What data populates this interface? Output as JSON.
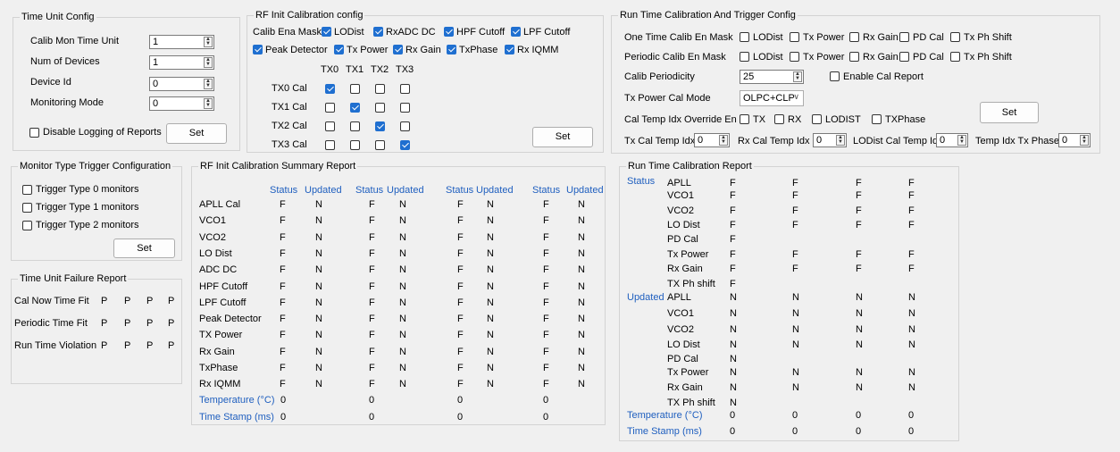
{
  "time_unit_config": {
    "title": "Time Unit Config",
    "fields": [
      {
        "label": "Calib Mon Time Unit",
        "value": "1"
      },
      {
        "label": "Num of  Devices",
        "value": "1"
      },
      {
        "label": "Device Id",
        "value": "0"
      },
      {
        "label": "Monitoring Mode",
        "value": "0"
      }
    ],
    "disable_logging_label": "Disable Logging of Reports",
    "disable_logging_checked": false,
    "set_label": "Set"
  },
  "rf_init_cal_config": {
    "title": "RF Init Calibration config",
    "ena_mask_label": "Calib Ena Mask",
    "mask_items": [
      {
        "label": "LODist",
        "checked": true
      },
      {
        "label": "RxADC DC",
        "checked": true
      },
      {
        "label": "HPF Cutoff",
        "checked": true
      },
      {
        "label": "LPF Cutoff",
        "checked": true
      },
      {
        "label": "Peak Detector",
        "checked": true
      },
      {
        "label": "Tx Power",
        "checked": true
      },
      {
        "label": "Rx Gain",
        "checked": true
      },
      {
        "label": "TxPhase",
        "checked": true
      },
      {
        "label": "Rx IQMM",
        "checked": true
      }
    ],
    "tx_columns": [
      "TX0",
      "TX1",
      "TX2",
      "TX3"
    ],
    "tx_rows": [
      {
        "label": "TX0 Cal",
        "checks": [
          true,
          false,
          false,
          false
        ]
      },
      {
        "label": "TX1 Cal",
        "checks": [
          false,
          true,
          false,
          false
        ]
      },
      {
        "label": "TX2 Cal",
        "checks": [
          false,
          false,
          true,
          false
        ]
      },
      {
        "label": "TX3 Cal",
        "checks": [
          false,
          false,
          false,
          true
        ]
      }
    ],
    "set_label": "Set"
  },
  "run_time_cal_config": {
    "title": "Run Time Calibration And Trigger Config",
    "mask_options": [
      "LODist",
      "Tx Power",
      "Rx Gain",
      "PD Cal",
      "Tx Ph Shift"
    ],
    "one_time_label": "One Time Calib En Mask",
    "periodic_label": "Periodic Calib En Mask",
    "periodicity_label": "Calib Periodicity",
    "periodicity_value": "25",
    "enable_cal_report_label": "Enable Cal Report",
    "tx_power_mode_label": "Tx Power Cal Mode",
    "tx_power_mode_value": "OLPC+CLP",
    "override_label": "Cal Temp Idx Override En",
    "override_options": [
      "TX",
      "RX",
      "LODIST",
      "TXPhase"
    ],
    "tx_temp_label": "Tx Cal Temp Idx",
    "tx_temp_value": "0",
    "rx_temp_label": "Rx Cal Temp Idx",
    "rx_temp_value": "0",
    "lodist_temp_label": "LODist Cal Temp Idx",
    "lodist_temp_value": "0",
    "txphase_temp_label": "Temp Idx Tx Phase",
    "txphase_temp_value": "0",
    "set_label": "Set"
  },
  "monitor_trigger": {
    "title": "Monitor Type Trigger Configuration",
    "options": [
      "Trigger Type 0 monitors",
      "Trigger Type 1 monitors",
      "Trigger Type 2 monitors"
    ],
    "set_label": "Set"
  },
  "time_unit_failure": {
    "title": "Time Unit Failure Report",
    "rows": [
      {
        "label": "Cal Now Time Fit",
        "values": [
          "P",
          "P",
          "P",
          "P"
        ]
      },
      {
        "label": "Periodic Time Fit",
        "values": [
          "P",
          "P",
          "P",
          "P"
        ]
      },
      {
        "label": "Run Time Violation",
        "values": [
          "P",
          "P",
          "P",
          "P"
        ]
      }
    ]
  },
  "rf_init_summary": {
    "title": "RF Init Calibration Summary Report",
    "headers": [
      "Status",
      "Updated"
    ],
    "rows": [
      {
        "label": "APLL Cal",
        "values": [
          "F",
          "N",
          "F",
          "N",
          "F",
          "N",
          "F",
          "N"
        ]
      },
      {
        "label": "VCO1",
        "values": [
          "F",
          "N",
          "F",
          "N",
          "F",
          "N",
          "F",
          "N"
        ]
      },
      {
        "label": "VCO2",
        "values": [
          "F",
          "N",
          "F",
          "N",
          "F",
          "N",
          "F",
          "N"
        ]
      },
      {
        "label": "LO Dist",
        "values": [
          "F",
          "N",
          "F",
          "N",
          "F",
          "N",
          "F",
          "N"
        ]
      },
      {
        "label": "ADC DC",
        "values": [
          "F",
          "N",
          "F",
          "N",
          "F",
          "N",
          "F",
          "N"
        ]
      },
      {
        "label": "HPF Cutoff",
        "values": [
          "F",
          "N",
          "F",
          "N",
          "F",
          "N",
          "F",
          "N"
        ]
      },
      {
        "label": "LPF Cutoff",
        "values": [
          "F",
          "N",
          "F",
          "N",
          "F",
          "N",
          "F",
          "N"
        ]
      },
      {
        "label": "Peak Detector",
        "values": [
          "F",
          "N",
          "F",
          "N",
          "F",
          "N",
          "F",
          "N"
        ]
      },
      {
        "label": "TX Power",
        "values": [
          "F",
          "N",
          "F",
          "N",
          "F",
          "N",
          "F",
          "N"
        ]
      },
      {
        "label": "Rx Gain",
        "values": [
          "F",
          "N",
          "F",
          "N",
          "F",
          "N",
          "F",
          "N"
        ]
      },
      {
        "label": "TxPhase",
        "values": [
          "F",
          "N",
          "F",
          "N",
          "F",
          "N",
          "F",
          "N"
        ]
      },
      {
        "label": "Rx IQMM",
        "values": [
          "F",
          "N",
          "F",
          "N",
          "F",
          "N",
          "F",
          "N"
        ]
      }
    ],
    "temperature_label": "Temperature (°C)",
    "temperature_values": [
      "0",
      "0",
      "0",
      "0"
    ],
    "timestamp_label": "Time Stamp (ms)",
    "timestamp_values": [
      "0",
      "0",
      "0",
      "0"
    ]
  },
  "run_time_report": {
    "title": "Run Time Calibration Report",
    "status_label": "Status",
    "updated_label": "Updated",
    "status_rows": [
      {
        "label": "APLL",
        "values": [
          "F",
          "F",
          "F",
          "F"
        ]
      },
      {
        "label": "VCO1",
        "values": [
          "F",
          "F",
          "F",
          "F"
        ]
      },
      {
        "label": "VCO2",
        "values": [
          "F",
          "F",
          "F",
          "F"
        ]
      },
      {
        "label": "LO Dist",
        "values": [
          "F",
          "F",
          "F",
          "F"
        ]
      },
      {
        "label": "PD Cal",
        "values": [
          "F"
        ]
      },
      {
        "label": "Tx Power",
        "values": [
          "F",
          "F",
          "F",
          "F"
        ]
      },
      {
        "label": "Rx Gain",
        "values": [
          "F",
          "F",
          "F",
          "F"
        ]
      },
      {
        "label": "TX Ph shift",
        "values": [
          "F"
        ]
      }
    ],
    "updated_rows": [
      {
        "label": "APLL",
        "values": [
          "N",
          "N",
          "N",
          "N"
        ]
      },
      {
        "label": "VCO1",
        "values": [
          "N",
          "N",
          "N",
          "N"
        ]
      },
      {
        "label": "VCO2",
        "values": [
          "N",
          "N",
          "N",
          "N"
        ]
      },
      {
        "label": "LO Dist",
        "values": [
          "N",
          "N",
          "N",
          "N"
        ]
      },
      {
        "label": "PD Cal",
        "values": [
          "N"
        ]
      },
      {
        "label": "Tx Power",
        "values": [
          "N",
          "N",
          "N",
          "N"
        ]
      },
      {
        "label": "Rx Gain",
        "values": [
          "N",
          "N",
          "N",
          "N"
        ]
      },
      {
        "label": "TX Ph shift",
        "values": [
          "N"
        ]
      }
    ],
    "temperature_label": "Temperature (°C)",
    "temperature_values": [
      "0",
      "0",
      "0",
      "0"
    ],
    "timestamp_label": "Time Stamp (ms)",
    "timestamp_values": [
      "0",
      "0",
      "0",
      "0"
    ]
  },
  "colors": {
    "accent": "#1f6fd0",
    "label_blue": "#1f5fbf",
    "background": "#f0f0f0"
  }
}
